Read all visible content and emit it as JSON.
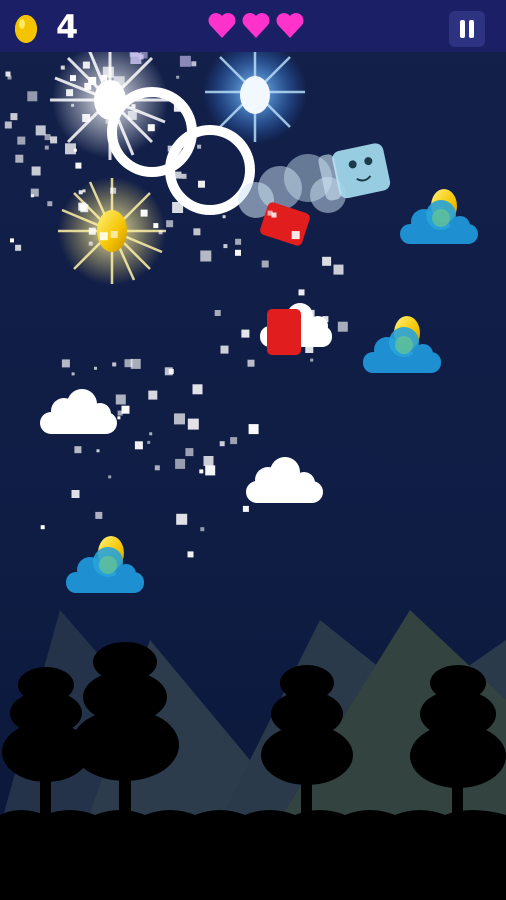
{
  "hud": {
    "egg_count": "4",
    "lives": 3,
    "pause_icon": "pause-icon",
    "egg_icon": "golden-egg-icon"
  },
  "colors": {
    "hud_bar": "#1a1f66",
    "heart": "#ff33cc",
    "sky": "#13204a",
    "gold_egg": "#f5c400",
    "blue_cloud": "#1e8fd1",
    "red_block": "#e11d1d",
    "player": "#9fd6ea"
  }
}
